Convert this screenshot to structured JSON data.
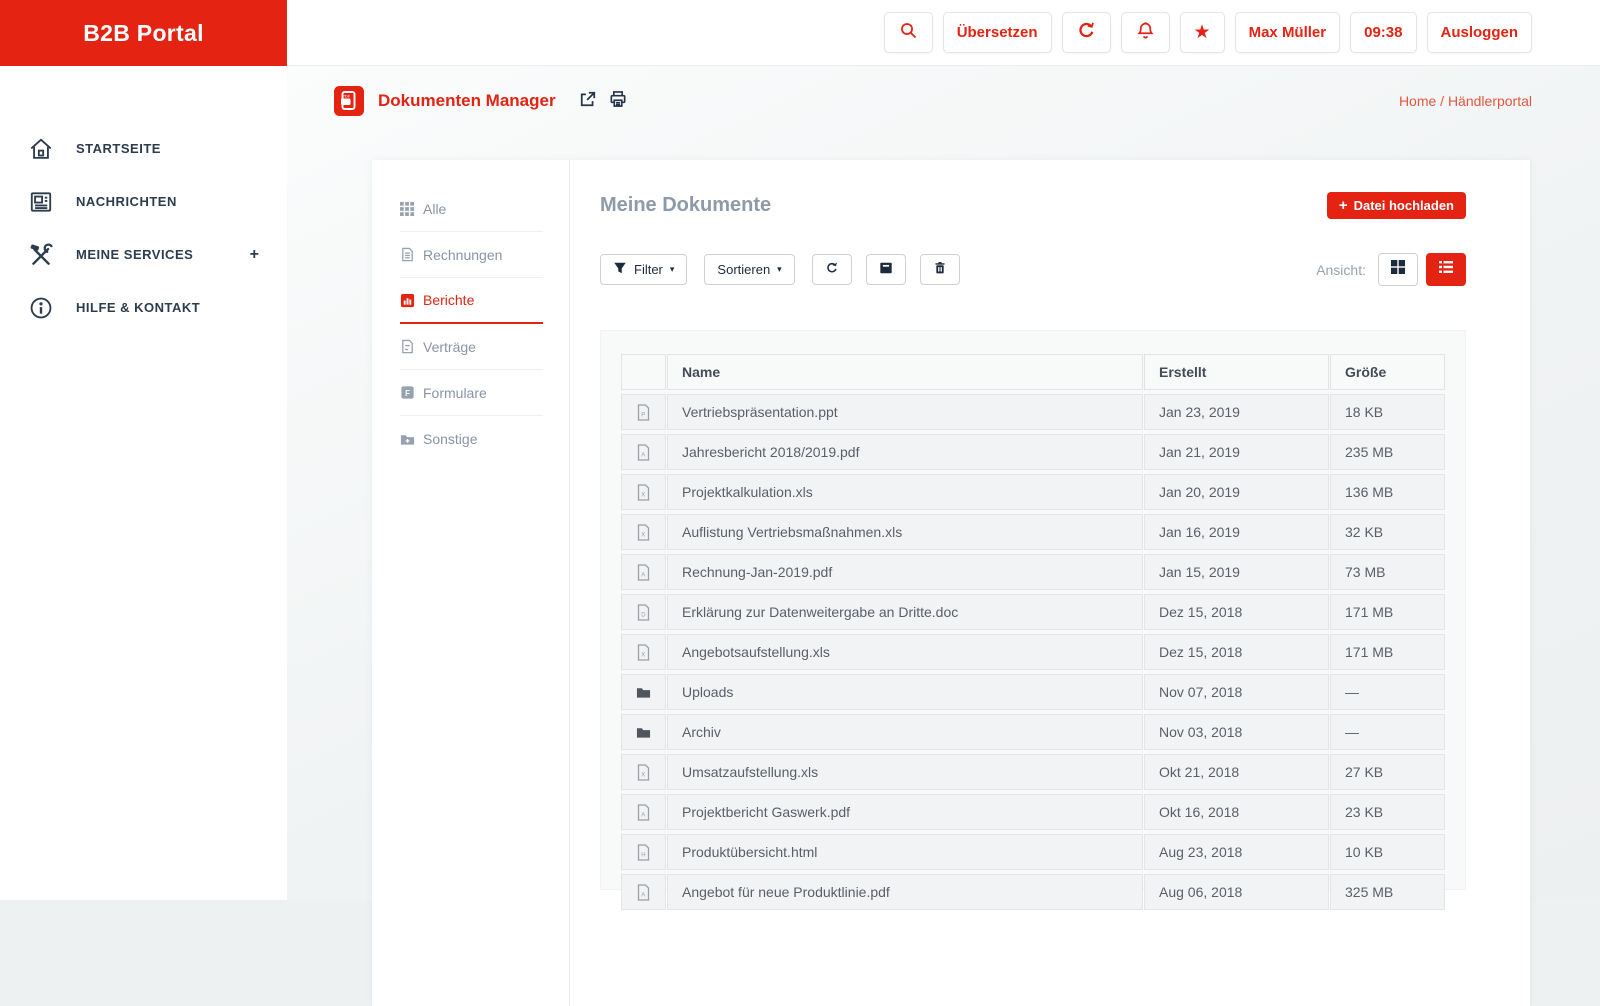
{
  "colors": {
    "primary_red": "#e42313",
    "sidebar_text": "#2d3c4e",
    "muted_text": "#a8adb3",
    "heading_gray": "#8e99a9",
    "panel_bg": "#f8f9f9"
  },
  "brand": {
    "logo_text": "B2B Portal"
  },
  "topbar": {
    "search_icon": "magnifier-icon",
    "translate_label": "Übersetzen",
    "refresh_icon": "refresh-icon",
    "bell_icon": "bell-icon",
    "star_icon": "star-icon",
    "star_glyph": "★",
    "user_label": "Max Müller",
    "time_label": "09:38",
    "logout_label": "Ausloggen"
  },
  "sidebar": {
    "items": [
      {
        "label": "STARTSEITE",
        "icon": "home-icon"
      },
      {
        "label": "NACHRICHTEN",
        "icon": "newspaper-icon"
      },
      {
        "label": "MEINE SERVICES",
        "icon": "tools-icon",
        "expander": "+"
      },
      {
        "label": "HILFE & KONTAKT",
        "icon": "help-icon"
      }
    ]
  },
  "page_header": {
    "app_icon": "document-manager-icon",
    "title": "Dokumenten Manager",
    "share_icon": "share-icon",
    "print_icon": "print-icon",
    "breadcrumb": "Home / Händlerportal"
  },
  "categories": {
    "items": [
      {
        "label": "Alle",
        "icon": "grid-icon",
        "active": false
      },
      {
        "label": "Rechnungen",
        "icon": "invoice-file-icon",
        "active": false
      },
      {
        "label": "Berichte",
        "icon": "report-chart-icon",
        "active": true
      },
      {
        "label": "Verträge",
        "icon": "contract-file-icon",
        "active": false
      },
      {
        "label": "Formulare",
        "icon": "form-file-icon",
        "active": false
      },
      {
        "label": "Sonstige",
        "icon": "folder-plus-icon",
        "active": false
      }
    ]
  },
  "main": {
    "title": "Meine Dokumente",
    "upload_button": {
      "plus": "+",
      "label": "Datei hochladen"
    },
    "toolbar": {
      "filter_label": "Filter",
      "filter_caret": "▾",
      "sort_label": "Sortieren",
      "sort_caret": "▾",
      "refresh_icon": "refresh-icon",
      "archive_icon": "archive-box-icon",
      "trash_icon": "trash-icon",
      "view_label": "Ansicht:",
      "grid_view_icon": "grid-view-icon",
      "list_view_icon": "list-view-icon",
      "active_view": "list"
    },
    "table": {
      "columns": [
        "Name",
        "Erstellt",
        "Größe"
      ],
      "empty_size_glyph": "—",
      "rows": [
        {
          "icon": "ppt-file-icon",
          "type": "ppt",
          "name": "Vertriebspräsentation.ppt",
          "created": "Jan 23, 2019",
          "size": "18 KB"
        },
        {
          "icon": "pdf-file-icon",
          "type": "pdf",
          "name": "Jahresbericht 2018/2019.pdf",
          "created": "Jan 21, 2019",
          "size": "235 MB"
        },
        {
          "icon": "xls-file-icon",
          "type": "xls",
          "name": "Projektkalkulation.xls",
          "created": "Jan 20, 2019",
          "size": "136 MB"
        },
        {
          "icon": "xls-file-icon",
          "type": "xls",
          "name": "Auflistung Vertriebsmaßnahmen.xls",
          "created": "Jan 16, 2019",
          "size": "32 KB"
        },
        {
          "icon": "pdf-file-icon",
          "type": "pdf",
          "name": "Rechnung-Jan-2019.pdf",
          "created": "Jan 15, 2019",
          "size": "73 MB"
        },
        {
          "icon": "doc-file-icon",
          "type": "doc",
          "name": "Erklärung zur Datenweitergabe an Dritte.doc",
          "created": "Dez 15, 2018",
          "size": "171 MB"
        },
        {
          "icon": "xls-file-icon",
          "type": "xls",
          "name": "Angebotsaufstellung.xls",
          "created": "Dez 15, 2018",
          "size": "171 MB"
        },
        {
          "icon": "folder-icon",
          "type": "folder",
          "name": "Uploads",
          "created": "Nov 07, 2018",
          "size": "—"
        },
        {
          "icon": "folder-icon",
          "type": "folder",
          "name": "Archiv",
          "created": "Nov 03, 2018",
          "size": "—"
        },
        {
          "icon": "xls-file-icon",
          "type": "xls",
          "name": "Umsatzaufstellung.xls",
          "created": "Okt 21, 2018",
          "size": "27 KB"
        },
        {
          "icon": "pdf-file-icon",
          "type": "pdf",
          "name": "Projektbericht Gaswerk.pdf",
          "created": "Okt 16, 2018",
          "size": "23 KB"
        },
        {
          "icon": "html-file-icon",
          "type": "html",
          "name": "Produktübersicht.html",
          "created": "Aug 23, 2018",
          "size": "10 KB"
        },
        {
          "icon": "pdf-file-icon",
          "type": "pdf",
          "name": "Angebot für neue Produktlinie.pdf",
          "created": "Aug 06, 2018",
          "size": "325 MB"
        }
      ]
    }
  }
}
